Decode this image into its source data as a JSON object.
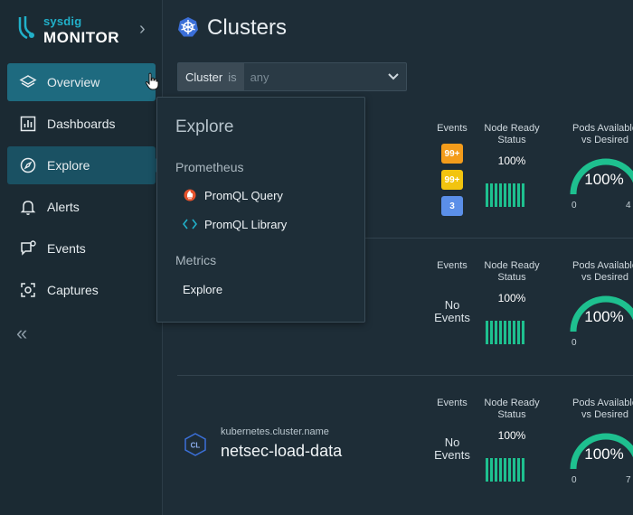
{
  "brand": {
    "sub": "sysdig",
    "main": "MONITOR"
  },
  "sidebar": {
    "items": [
      {
        "label": "Overview",
        "icon": "layers-icon"
      },
      {
        "label": "Dashboards",
        "icon": "bar-chart-icon"
      },
      {
        "label": "Explore",
        "icon": "compass-icon"
      },
      {
        "label": "Alerts",
        "icon": "bell-icon"
      },
      {
        "label": "Events",
        "icon": "chat-bubble-icon"
      },
      {
        "label": "Captures",
        "icon": "capture-icon"
      }
    ],
    "collapse": "«"
  },
  "page": {
    "title": "Clusters"
  },
  "filter": {
    "key": "Cluster",
    "operator": "is",
    "value": "any"
  },
  "columns": {
    "events": "Events",
    "node_ready_1": "Node Ready",
    "node_ready_2": "Status",
    "pods_1": "Pods Available",
    "pods_2": "vs Desired"
  },
  "clusters": [
    {
      "key": "",
      "name": "",
      "badges": [
        "99+",
        "99+",
        "3"
      ],
      "no_events": null,
      "node_ready": "100%",
      "pods": "100%",
      "pods_min": "0",
      "pods_max": "4"
    },
    {
      "key": "",
      "name": "",
      "badges": [],
      "no_events": [
        "No",
        "Events"
      ],
      "node_ready": "100%",
      "pods": "100%",
      "pods_min": "0",
      "pods_max": ""
    },
    {
      "key": "kubernetes.cluster.name",
      "name": "netsec-load-data",
      "icon_text": "CL",
      "badges": [],
      "no_events": [
        "No",
        "Events"
      ],
      "node_ready": "100%",
      "pods": "100%",
      "pods_min": "0",
      "pods_max": "7"
    }
  ],
  "flyout": {
    "title": "Explore",
    "sections": [
      {
        "label": "Prometheus",
        "items": [
          "PromQL Query",
          "PromQL Library"
        ]
      },
      {
        "label": "Metrics",
        "items": [
          "Explore"
        ]
      }
    ]
  },
  "colors": {
    "accent": "#1ec08f",
    "badge_orange": "#f39c1b",
    "badge_yellow": "#f2c40f",
    "badge_blue": "#5b8fe8"
  }
}
